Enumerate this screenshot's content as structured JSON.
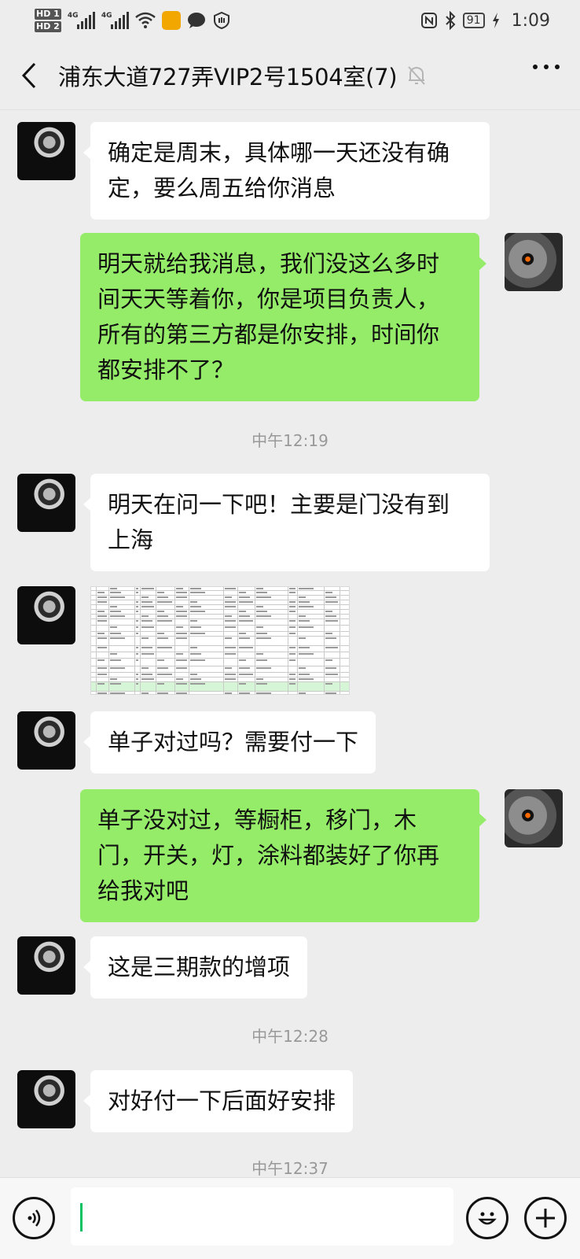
{
  "status_bar": {
    "hd1": "HD 1",
    "hd2": "HD 2",
    "net1": "4G",
    "net2": "4G",
    "battery": "91",
    "time": "1:09"
  },
  "header": {
    "title": "浦东大道727弄VIP2号1504室(7)",
    "back_icon": "chevron-left-icon",
    "mute_icon": "bell-off-icon",
    "more_icon": "more-horizontal-icon"
  },
  "messages": [
    {
      "side": "in",
      "text_lines": [
        "确定是周末，具体哪一天还没有确",
        "定，要么周五给你消息"
      ]
    },
    {
      "side": "out",
      "text_lines": [
        "明天就给我消息，我们没这么多时",
        "间天天等着你，你是项目负责人，",
        "所有的第三方都是你安排，时间你",
        "都安排不了？"
      ]
    },
    {
      "side": "time",
      "text": "中午12:19"
    },
    {
      "side": "in",
      "text_lines": [
        "明天在问一下吧！主要是门没有到",
        "上海"
      ]
    },
    {
      "side": "in",
      "type": "image",
      "image": "spreadsheet-thumbnail"
    },
    {
      "side": "in",
      "text_lines": [
        "单子对过吗？需要付一下"
      ]
    },
    {
      "side": "out",
      "text_lines": [
        "单子没对过，等橱柜，移门，木",
        "门，开关，灯，涂料都装好了你再",
        "给我对吧"
      ]
    },
    {
      "side": "in",
      "text_lines": [
        "这是三期款的增项"
      ]
    },
    {
      "side": "time",
      "text": "中午12:28"
    },
    {
      "side": "in",
      "text_lines": [
        "对好付一下后面好安排"
      ]
    },
    {
      "side": "time",
      "text": "中午12:37"
    }
  ],
  "input_bar": {
    "voice_icon": "voice-icon",
    "emoji_icon": "emoji-icon",
    "plus_icon": "plus-icon",
    "value": ""
  },
  "colors": {
    "background": "#ededed",
    "bubble_in": "#ffffff",
    "bubble_out": "#95ec69",
    "caret": "#07c160"
  }
}
